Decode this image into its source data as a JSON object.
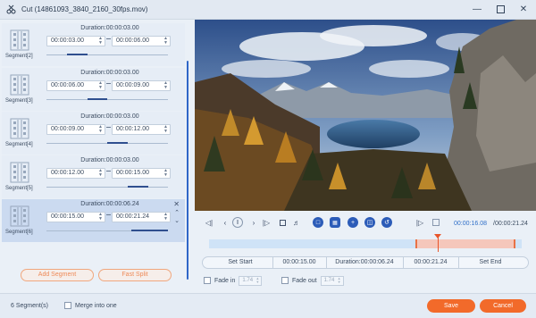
{
  "window": {
    "title": "Cut (14861093_3840_2160_30fps.mov)"
  },
  "segments": [
    {
      "label": "Segment[2]",
      "duration": "Duration:00:00:03.00",
      "start": "00:00:03.00",
      "end": "00:00:06.00",
      "range": [
        0.17,
        0.34
      ]
    },
    {
      "label": "Segment[3]",
      "duration": "Duration:00:00:03.00",
      "start": "00:00:06.00",
      "end": "00:00:09.00",
      "range": [
        0.34,
        0.5
      ]
    },
    {
      "label": "Segment[4]",
      "duration": "Duration:00:00:03.00",
      "start": "00:00:09.00",
      "end": "00:00:12.00",
      "range": [
        0.5,
        0.67
      ]
    },
    {
      "label": "Segment[5]",
      "duration": "Duration:00:00:03.00",
      "start": "00:00:12.00",
      "end": "00:00:15.00",
      "range": [
        0.67,
        0.84
      ]
    },
    {
      "label": "Segment[6]",
      "duration": "Duration:00:00:06.24",
      "start": "00:00:15.00",
      "end": "00:00:21.24",
      "range": [
        0.7,
        1.0
      ]
    }
  ],
  "buttons": {
    "add_segment": "Add Segment",
    "fast_split": "Fast Split",
    "set_start": "Set Start",
    "set_end": "Set End",
    "save": "Save",
    "cancel": "Cancel"
  },
  "player": {
    "current_time": "00:00:16.08",
    "total_time": "/00:00:21.24",
    "selection_start_fraction": 0.66,
    "selection_end_fraction": 0.98,
    "playhead_fraction": 0.73
  },
  "setbar": {
    "start": "00:00:15.00",
    "duration": "Duration:00:00:06.24",
    "end": "00:00:21.24"
  },
  "fade": {
    "in_label": "Fade in",
    "in_value": "1.74",
    "out_label": "Fade out",
    "out_value": "1.74"
  },
  "footer": {
    "segment_count": "6 Segment(s)",
    "merge_label": "Merge into one"
  },
  "colors": {
    "accent": "#f26a2a",
    "primary": "#2c5cb8",
    "active_row": "#cbdaf0"
  }
}
